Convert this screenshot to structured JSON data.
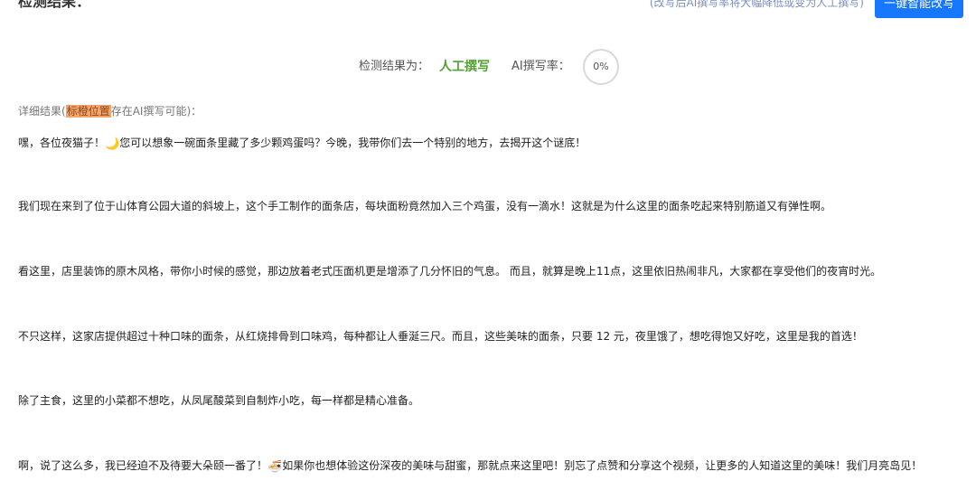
{
  "header": {
    "title": "检测结果：",
    "hint": "(改写后AI撰写率将大幅降低或变为人工撰写)",
    "rewrite_button_label": "一键智能改写"
  },
  "summary": {
    "result_label": "检测结果为：",
    "result_value": "人工撰写",
    "rate_label": "AI撰写率：",
    "rate_value": "0%"
  },
  "detail": {
    "prefix": "详细结果(",
    "highlight_text": "标橙位置",
    "suffix": "存在AI撰写可能)："
  },
  "icons": {
    "moon": "crescent-moon-icon",
    "noodle": "noodle-bowl-icon"
  },
  "paragraphs": {
    "p1_a": "嘿，各位夜猫子！",
    "p1_emoji": "🌙",
    "p1_b": "您可以想象一碗面条里藏了多少颗鸡蛋吗？今晚，我带你们去一个特别的地方，去揭开这个谜底！",
    "p2": "我们现在来到了位于山体育公园大道的斜坡上，这个手工制作的面条店，每块面粉竟然加入三个鸡蛋，没有一滴水！这就是为什么这里的面条吃起来特别筋道又有弹性啊。",
    "p3": "看这里，店里装饰的原木风格，带你小时候的感觉，那边放着老式压面机更是增添了几分怀旧的气息。 而且，就算是晚上11点，这里依旧热闹非凡，大家都在享受他们的夜宵时光。",
    "p4": "不只这样，这家店提供超过十种口味的面条，从红烧排骨到口味鸡，每种都让人垂涎三尺。而且，这些美味的面条，只要 12 元，夜里饿了，想吃得饱又好吃，这里是我的首选！",
    "p5": "除了主食，这里的小菜都不想吃，从凤尾酸菜到自制炸小吃，每一样都是精心准备。",
    "p6_a": "啊，说了这么多，我已经迫不及待要大朵颐一番了！",
    "p6_emoji": "🍜",
    "p6_b": "如果你也想体验这份深夜的美味与甜蜜，那就点来这里吧！别忘了点赞和分享这个视频，让更多的人知道这里的美味！我们月亮岛见！"
  }
}
